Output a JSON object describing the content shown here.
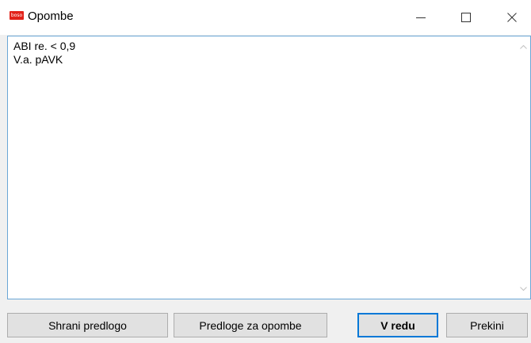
{
  "window": {
    "title": "Opombe",
    "logo_text": "boso",
    "brand_color": "#e2231a",
    "controls": [
      "minimize-icon",
      "maximize-icon",
      "close-icon"
    ]
  },
  "notes": {
    "line1": "ABI re. < 0,9",
    "line2": "V.a. pAVK",
    "border_color": "#6aa6d6"
  },
  "buttons": {
    "save_template": "Shrani predlogo",
    "templates": "Predloge za opombe",
    "ok": "V redu",
    "cancel": "Prekini",
    "default_accent": "#0078d7"
  }
}
